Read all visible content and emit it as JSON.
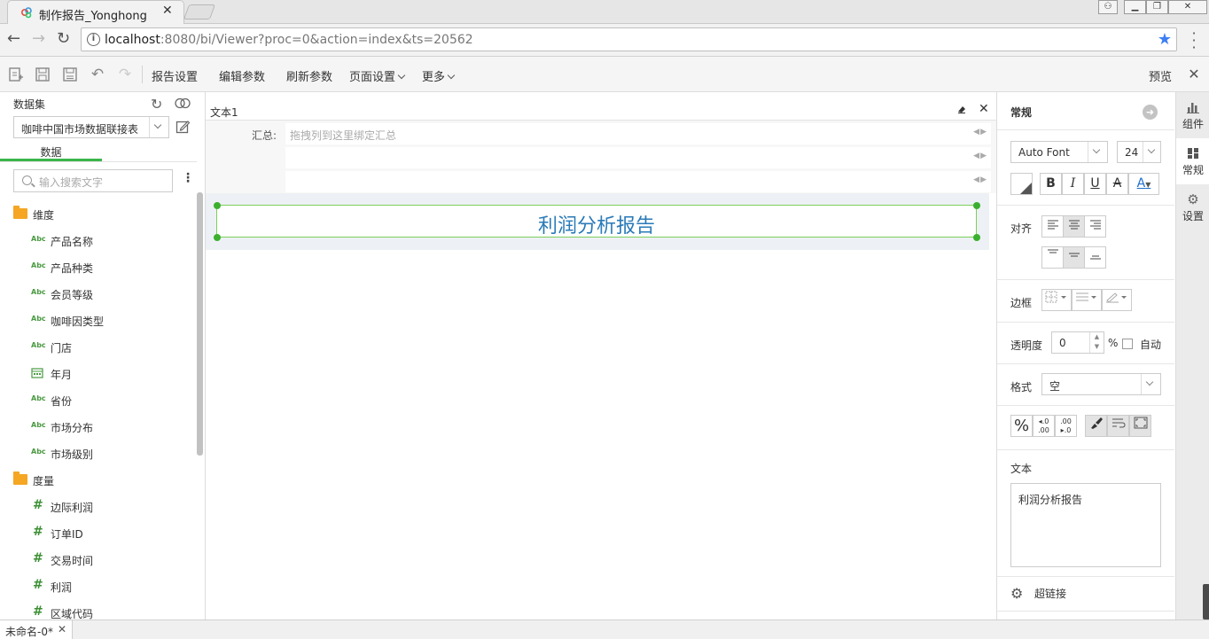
{
  "browser": {
    "tab_title": "制作报告_Yonghong",
    "url_host": "localhost",
    "url_rest": ":8080/bi/Viewer?proc=0&action=index&ts=20562"
  },
  "toolbar": {
    "report_settings": "报告设置",
    "edit_params": "编辑参数",
    "refresh_params": "刷新参数",
    "page_settings": "页面设置",
    "more": "更多",
    "preview": "预览"
  },
  "left": {
    "dataset_label": "数据集",
    "dataset_value": "咖啡中国市场数据联接表",
    "data_tab": "数据",
    "search_placeholder": "输入搜索文字",
    "dimension_folder": "维度",
    "dimensions": [
      {
        "type": "Abc",
        "name": "产品名称"
      },
      {
        "type": "Abc",
        "name": "产品种类"
      },
      {
        "type": "Abc",
        "name": "会员等级"
      },
      {
        "type": "Abc",
        "name": "咖啡因类型"
      },
      {
        "type": "Abc",
        "name": "门店"
      },
      {
        "type": "date",
        "name": "年月"
      },
      {
        "type": "Abc",
        "name": "省份"
      },
      {
        "type": "Abc",
        "name": "市场分布"
      },
      {
        "type": "Abc",
        "name": "市场级别"
      }
    ],
    "measure_folder": "度量",
    "measures": [
      {
        "type": "#",
        "name": "边际利润"
      },
      {
        "type": "#",
        "name": "订单ID"
      },
      {
        "type": "#",
        "name": "交易时间"
      },
      {
        "type": "#",
        "name": "利润"
      },
      {
        "type": "#",
        "name": "区域代码"
      }
    ]
  },
  "center": {
    "component_name": "文本1",
    "summary_label": "汇总:",
    "summary_placeholder": "拖拽列到这里绑定汇总",
    "text_value": "利润分析报告"
  },
  "right": {
    "general_title": "常规",
    "font_name": "Auto Font",
    "font_size": "24",
    "bold": "B",
    "italic": "I",
    "underline": "U",
    "strike": "A",
    "font_color": "A",
    "align_label": "对齐",
    "border_label": "边框",
    "opacity_label": "透明度",
    "opacity_value": "0",
    "percent": "%",
    "auto_label": "自动",
    "format_label": "格式",
    "format_value": "空",
    "text_label": "文本",
    "text_value": "利润分析报告",
    "hyperlink_label": "超链接",
    "accent_color": "#3bb54a",
    "title_color": "#2a7ab8"
  },
  "sidetabs": {
    "components": "组件",
    "general": "常规",
    "settings": "设置"
  },
  "bottom": {
    "tab_name": "未命名-0*"
  }
}
